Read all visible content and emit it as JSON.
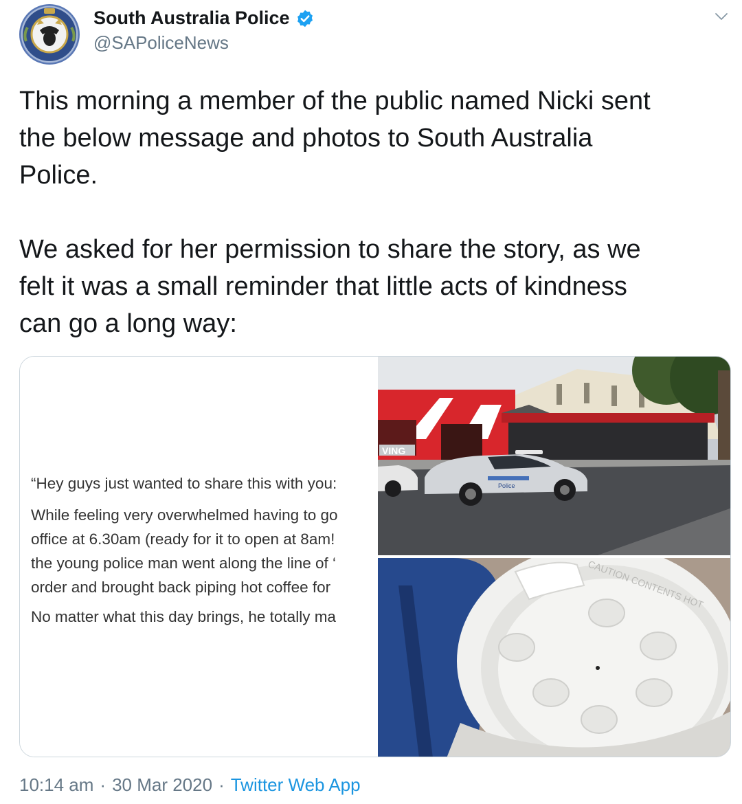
{
  "account": {
    "display_name": "South Australia Police",
    "handle": "@SAPoliceNews",
    "verified": true
  },
  "tweet": {
    "paragraphs": [
      "This morning a member of the public named Nicki sent\nthe below message and photos to South Australia\nPolice.",
      "We asked for her permission to share the story, as we\nfelt it was a small reminder that little acts of kindness\ncan go a long way:"
    ]
  },
  "media": {
    "message_lines": [
      "“Hey guys just wanted to share this with you:",
      "While feeling very overwhelmed having to go\noffice at 6.30am (ready for it to open at 8am!\nthe young police man went along the line of ‘\norder and brought back piping hot coffee for",
      "No matter what this day brings, he totally ma"
    ],
    "photo_signage": "VING",
    "photo_car_text": "Police",
    "photo_cup_rim_text": "CAUTION CONTENTS HOT"
  },
  "footer": {
    "time": "10:14 am",
    "separator": "·",
    "date": "30 Mar 2020",
    "source": "Twitter Web App"
  },
  "colors": {
    "text": "#14171a",
    "muted": "#657786",
    "link": "#1b95e0",
    "verified": "#1da1f2",
    "border": "#ccd6dd"
  },
  "icons": [
    "police-badge-avatar",
    "verified-badge-icon",
    "chevron-down-icon"
  ]
}
